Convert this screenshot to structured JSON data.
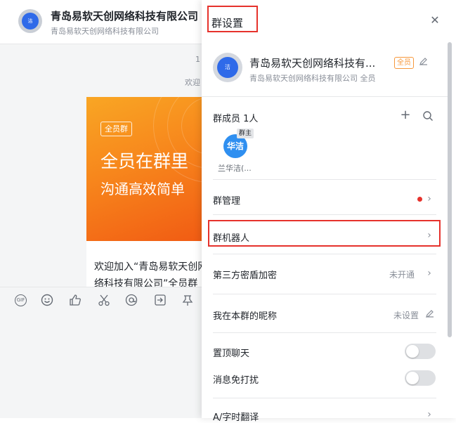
{
  "chat": {
    "avatar_text": "洁",
    "title": "青岛易软天创网络科技有限公司",
    "subtitle": "青岛易软天创网络科技有限公司",
    "time_stub": "1",
    "welcome_stub": "欢迎",
    "card": {
      "tag": "全员群",
      "headline1": "全员在群里",
      "headline2": "沟通高效简单",
      "text": "欢迎加入“青岛易软天创网络科技有限公司”全员群"
    },
    "toolbar": [
      "gif-icon",
      "emoji-icon",
      "thumbs-up-icon",
      "scissors-icon",
      "at-icon",
      "share-icon",
      "folder-icon",
      "pin-icon"
    ]
  },
  "panel": {
    "title": "群设置",
    "group": {
      "avatar_text": "洁",
      "name": "青岛易软天创网络科技有...",
      "badge": "全员",
      "sub": "青岛易软天创网络科技有限公司 全员"
    },
    "members": {
      "label": "群成员 1人",
      "avatar_text": "华洁",
      "owner_badge": "群主",
      "name": "兰华洁(..."
    },
    "rows": {
      "group_manage": "群管理",
      "group_robot": "群机器人",
      "third_party": "第三方密盾加密",
      "third_party_value": "未开通",
      "nickname": "我在本群的昵称",
      "nickname_value": "未设置",
      "pin_chat": "置顶聊天",
      "mute": "消息免打扰",
      "translate": "A/字时翻译"
    },
    "toggles": {
      "pin_chat_on": false,
      "mute_on": false
    },
    "colors": {
      "highlight": "#e6322c",
      "accent": "#2f6ae9",
      "badge": "#f7983b"
    }
  }
}
